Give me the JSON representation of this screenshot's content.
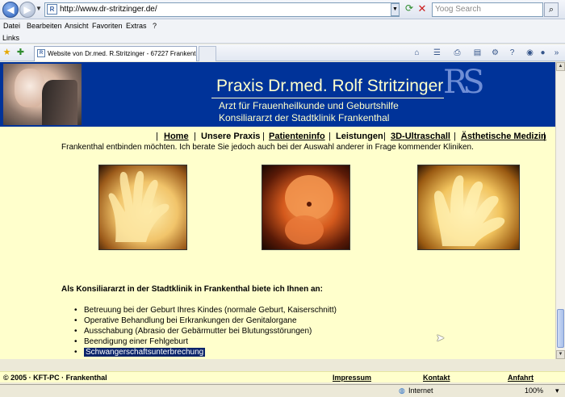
{
  "browser": {
    "address": "http://www.dr-stritzinger.de/",
    "search_placeholder": "Yoog Search",
    "menu": [
      "Datei",
      "Bearbeiten",
      "Ansicht",
      "Favoriten",
      "Extras",
      "?"
    ],
    "links_label": "Links",
    "tab_title": "Website von Dr.med. R.Stritzinger - 67227 Frankenthal"
  },
  "header": {
    "title": "Praxis Dr.med. Rolf Stritzinger",
    "subtitle1": "Arzt für Frauenheilkunde und Geburtshilfe",
    "subtitle2": "Konsiliararzt der Stadtklinik Frankenthal",
    "logo": "RS"
  },
  "nav": {
    "items": [
      "Home",
      "Unsere Praxis",
      "Patienteninfo",
      "Leistungen",
      "3D-Ultraschall",
      "Ästhetische Medizin"
    ],
    "separator": "|"
  },
  "main": {
    "intro": "Frankenthal entbinden möchten. Ich berate Sie jedoch auch bei der Auswahl anderer in Frage kommender Kliniken.",
    "services_heading": "Als Konsiliararzt in der Stadtklinik in Frankenthal biete ich Ihnen an:",
    "services": [
      "Betreuung bei der Geburt Ihres Kindes (normale Geburt, Kaiserschnitt)",
      "Operative Behandlung bei Erkrankungen der Genitalorgane",
      "Ausschabung (Abrasio der Gebärmutter bei Blutungsstörungen)",
      "Beendigung einer Fehlgeburt",
      "Schwangerschaftsunterbrechung"
    ]
  },
  "footer": {
    "copyright": "© 2005 · KFT-PC · Frankenthal",
    "impressum": "Impressum",
    "kontakt": "Kontakt",
    "anfahrt": "Anfahrt"
  },
  "status": {
    "zone": "Internet",
    "zoom": "100%"
  },
  "colors": {
    "header_bg": "#003399",
    "page_bg": "#ffffcc",
    "accent_text": "#ffffcc"
  }
}
